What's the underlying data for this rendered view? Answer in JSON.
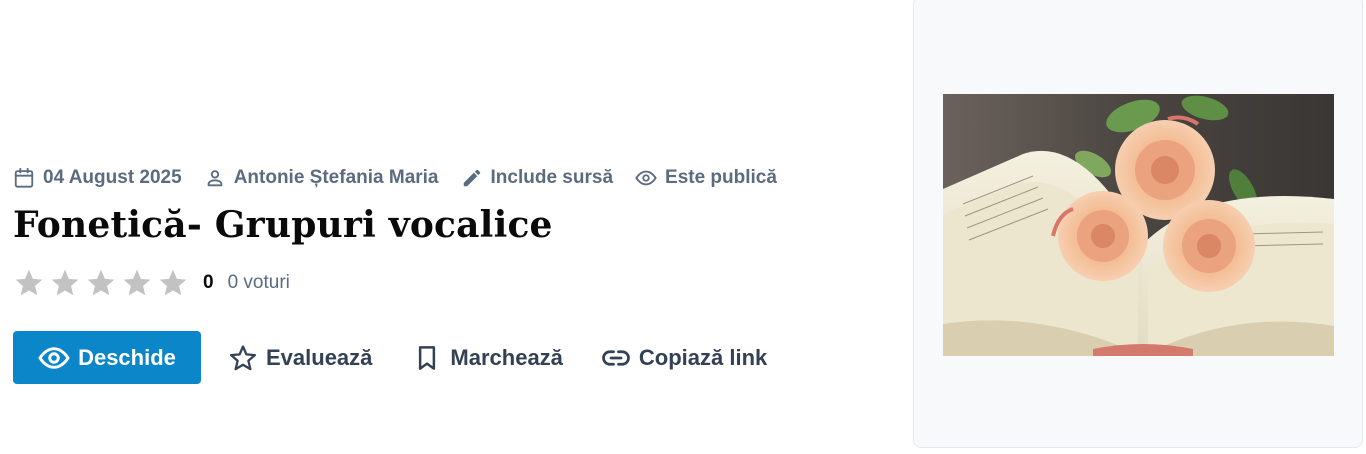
{
  "meta": {
    "date": "04 August 2025",
    "author": "Antonie Ștefania Maria",
    "source": "Include sursă",
    "visibility": "Este publică"
  },
  "title": "Fonetică- Grupuri vocalice",
  "rating": {
    "stars_total": 5,
    "stars_filled": 0,
    "value": "0",
    "votes": "0 voturi"
  },
  "actions": {
    "open": "Deschide",
    "rate": "Evaluează",
    "bookmark": "Marchează",
    "copy_link": "Copiază link"
  },
  "colors": {
    "primary": "#0b86c9",
    "meta_text": "#5b6b80",
    "action_text": "#334155",
    "star_empty": "#c2c2c2"
  },
  "icons": {
    "date": "calendar-icon",
    "author": "user-icon",
    "source": "pencil-icon",
    "visibility": "eye-icon"
  },
  "image": {
    "subject": "open book with peach roses"
  }
}
